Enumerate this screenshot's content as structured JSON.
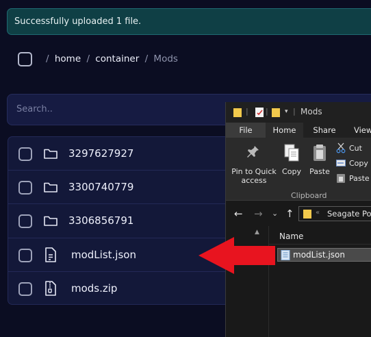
{
  "toast": {
    "message": "Successfully uploaded 1 file."
  },
  "breadcrumb": {
    "root_sep": "/",
    "items": [
      "home",
      "container",
      "Mods"
    ],
    "seps": [
      "/",
      "/"
    ]
  },
  "search": {
    "placeholder": "Search.."
  },
  "files": [
    {
      "name": "3297627927",
      "type": "folder",
      "icon": "folder-icon"
    },
    {
      "name": "3300740779",
      "type": "folder",
      "icon": "folder-icon"
    },
    {
      "name": "3306856791",
      "type": "folder",
      "icon": "folder-icon"
    },
    {
      "name": "modList.json",
      "type": "file",
      "icon": "document-icon"
    },
    {
      "name": "mods.zip",
      "type": "file",
      "icon": "zip-file-icon"
    }
  ],
  "explorer": {
    "title": "Mods",
    "tabs": {
      "file": "File",
      "home": "Home",
      "share": "Share",
      "view": "View"
    },
    "ribbon": {
      "pin_label": "Pin to Quick access",
      "copy_label": "Copy",
      "paste_label": "Paste",
      "cut_label": "Cut",
      "copy_path_label": "Copy p",
      "paste_shortcut_label": "Paste s",
      "group_label": "Clipboard"
    },
    "address": {
      "chevrons": "«",
      "path": "Seagate Port"
    },
    "column_header": "Name",
    "selected_file": "modList.json"
  },
  "colors": {
    "background": "#0b0d22",
    "toast_bg": "#0f3f45",
    "arrow": "#e8141f"
  }
}
